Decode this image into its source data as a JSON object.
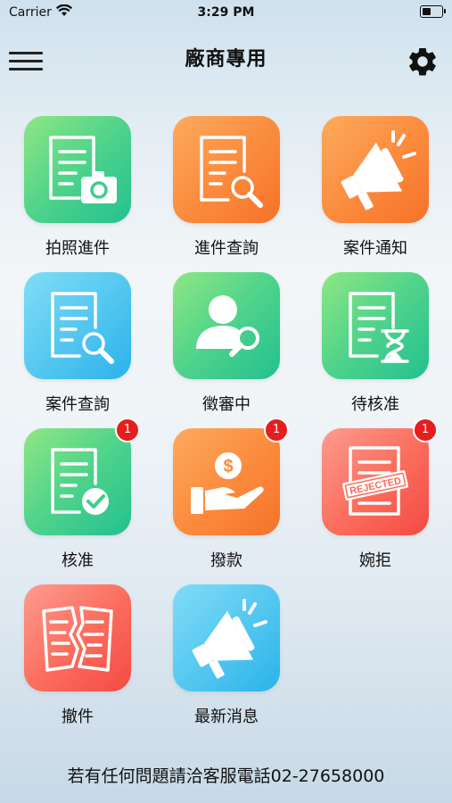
{
  "status_bar": {
    "carrier": "Carrier",
    "time": "3:29 PM"
  },
  "header": {
    "title": "廠商專用"
  },
  "tiles": [
    {
      "label": "拍照進件"
    },
    {
      "label": "進件查詢"
    },
    {
      "label": "案件通知"
    },
    {
      "label": "案件查詢"
    },
    {
      "label": "徵審中"
    },
    {
      "label": "待核准"
    },
    {
      "label": "核准",
      "badge": "1"
    },
    {
      "label": "撥款",
      "badge": "1"
    },
    {
      "label": "婉拒",
      "badge": "1",
      "stamp": "REJECTED"
    },
    {
      "label": "撤件"
    },
    {
      "label": "最新消息"
    }
  ],
  "footer": {
    "text": "若有任何問題請洽客服電話02-27658000"
  },
  "icons": [
    "wifi-icon",
    "battery-icon",
    "menu-icon",
    "gear-icon",
    "document-camera-icon",
    "document-search-icon",
    "megaphone-icon",
    "document-search-icon",
    "user-search-icon",
    "document-hourglass-icon",
    "document-check-icon",
    "money-hand-icon",
    "rejected-document-icon",
    "torn-document-icon",
    "megaphone-icon"
  ],
  "colors": {
    "green": "#4fd38b",
    "orange": "#fb8a3c",
    "blue": "#52c6f0",
    "red": "#fb6b5b",
    "badge": "#e61e1e"
  }
}
